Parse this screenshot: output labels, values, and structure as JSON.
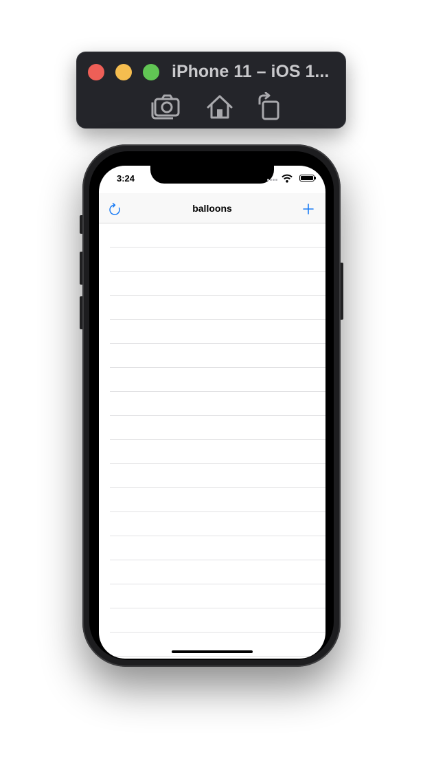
{
  "simulator": {
    "title": "iPhone 11 – iOS 1...",
    "toolbar_icons": [
      "screenshot-icon",
      "home-icon",
      "rotate-icon"
    ]
  },
  "status_bar": {
    "time": "3:24"
  },
  "nav_bar": {
    "title": "balloons",
    "left_icon": "refresh-icon",
    "right_icon": "add-icon"
  },
  "table": {
    "rows": [
      "",
      "",
      "",
      "",
      "",
      "",
      "",
      "",
      "",
      "",
      "",
      "",
      "",
      "",
      "",
      "",
      "",
      ""
    ]
  },
  "colors": {
    "accent": "#1a7cf5",
    "sim_bar": "#24252a",
    "close": "#ee5f57",
    "minimize": "#f5bd4f",
    "zoom": "#61c554"
  }
}
